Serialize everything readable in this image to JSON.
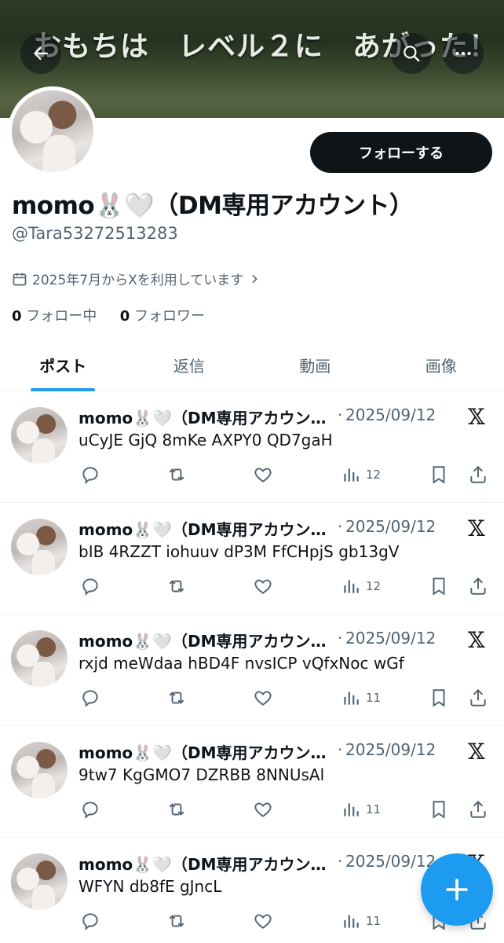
{
  "banner": {
    "caption": "おもちは　レベル２に　あがった！"
  },
  "header": {
    "back_icon": "arrow-left-icon",
    "search_icon": "search-icon",
    "more_icon": "more-horizontal-icon"
  },
  "profile": {
    "display_name": "momo🐰🤍（DM専用アカウント）",
    "handle": "@Tara53272513283",
    "joined": "2025年7月からXを利用しています",
    "following_count": "0",
    "following_label": "フォロー中",
    "followers_count": "0",
    "followers_label": "フォロワー",
    "follow_button": "フォローする"
  },
  "tabs": [
    {
      "label": "ポスト",
      "active": true
    },
    {
      "label": "返信",
      "active": false
    },
    {
      "label": "動画",
      "active": false
    },
    {
      "label": "画像",
      "active": false
    }
  ],
  "posts": [
    {
      "name": "momo🐰🤍（DM専用アカウント）",
      "date": "2025/09/12",
      "text": "uCyJE GjQ 8mKe AXPY0 QD7gaH",
      "views": "12"
    },
    {
      "name": "momo🐰🤍（DM専用アカウント）",
      "date": "2025/09/12",
      "text": "bIB 4RZZT iohuuv dP3M FfCHpjS gb13gV",
      "views": "12"
    },
    {
      "name": "momo🐰🤍（DM専用アカウント）",
      "date": "2025/09/12",
      "text": "rxjd meWdaa hBD4F nvsICP vQfxNoc wGf",
      "views": "11"
    },
    {
      "name": "momo🐰🤍（DM専用アカウント）",
      "date": "2025/09/12",
      "text": "9tw7 KgGMO7 DZRBB 8NNUsAl",
      "views": "11"
    },
    {
      "name": "momo🐰🤍（DM専用アカウント）",
      "date": "2025/09/12",
      "text": "WFYN db8fE gJncL",
      "views": "11"
    }
  ],
  "post_separator": "·",
  "post_source_icon": "x-logo-icon",
  "fab": {
    "icon": "plus-icon"
  },
  "colors": {
    "accent": "#1d9bf0",
    "text": "#0f1419",
    "muted": "#536471",
    "follow_bg": "#0f1419"
  }
}
